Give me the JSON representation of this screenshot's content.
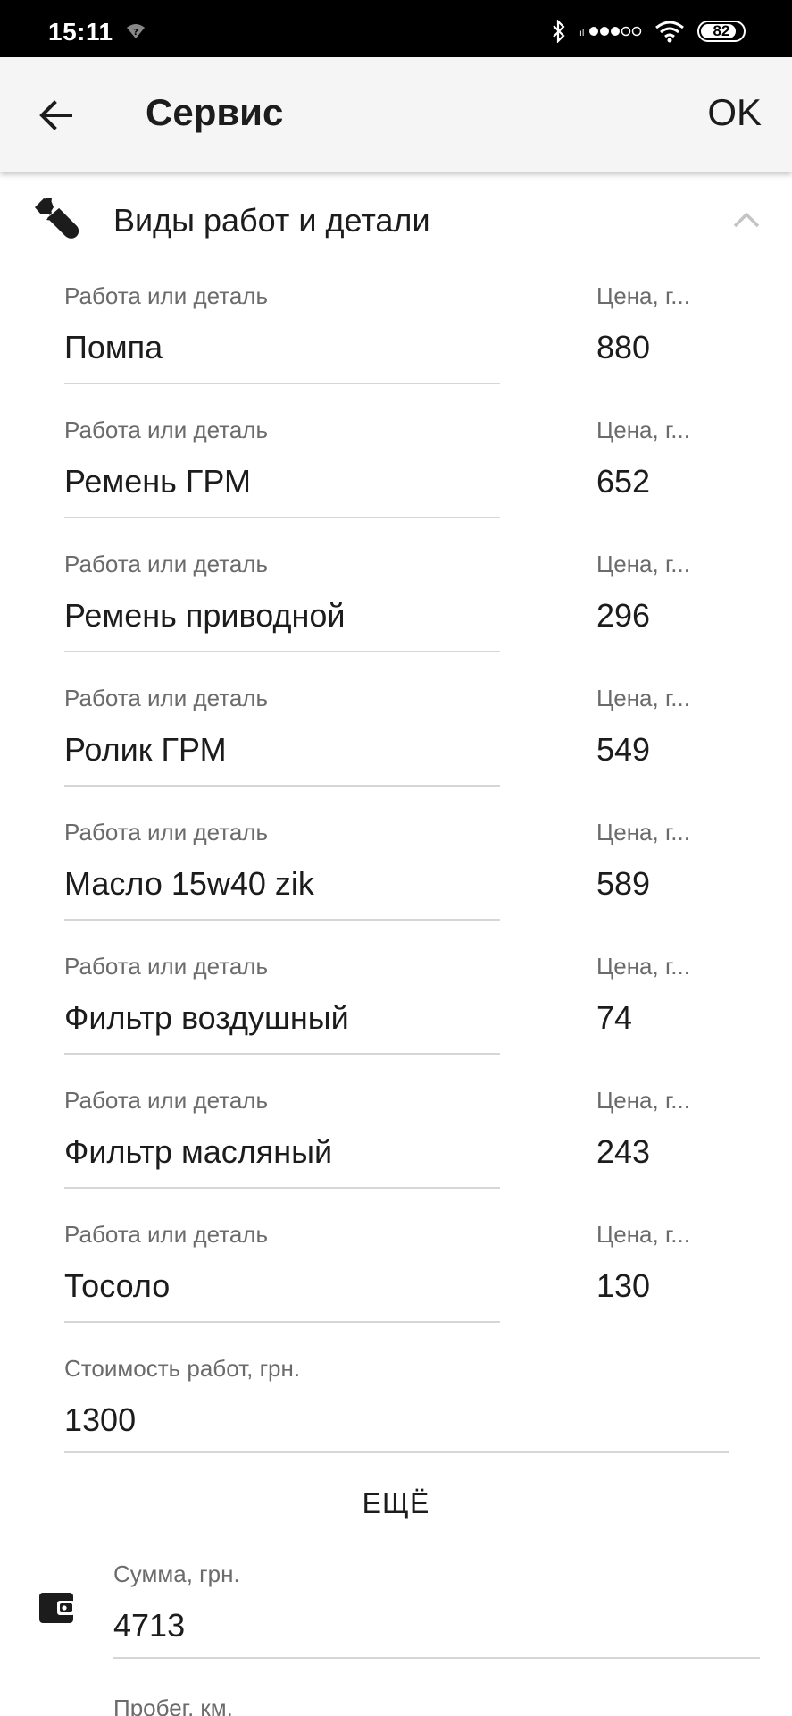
{
  "status_bar": {
    "time": "15:11",
    "battery": "82"
  },
  "app_bar": {
    "title": "Сервис",
    "ok_label": "OK"
  },
  "section": {
    "title": "Виды работ и детали"
  },
  "parts": [
    {
      "label": "Работа или деталь",
      "name": "Помпа",
      "price_label": "Цена, г...",
      "price": "880"
    },
    {
      "label": "Работа или деталь",
      "name": "Ремень ГРМ",
      "price_label": "Цена, г...",
      "price": "652"
    },
    {
      "label": "Работа или деталь",
      "name": "Ремень приводной",
      "price_label": "Цена, г...",
      "price": "296"
    },
    {
      "label": "Работа или деталь",
      "name": "Ролик ГРМ",
      "price_label": "Цена, г...",
      "price": "549"
    },
    {
      "label": "Работа или деталь",
      "name": "Масло 15w40 zik",
      "price_label": "Цена, г...",
      "price": "589"
    },
    {
      "label": "Работа или деталь",
      "name": "Фильтр воздушный",
      "price_label": "Цена, г...",
      "price": "74"
    },
    {
      "label": "Работа или деталь",
      "name": "Фильтр масляный",
      "price_label": "Цена, г...",
      "price": "243"
    },
    {
      "label": "Работа или деталь",
      "name": "Тосоло",
      "price_label": "Цена, г...",
      "price": "130"
    }
  ],
  "labor_cost": {
    "label": "Стоимость работ, грн.",
    "value": "1300"
  },
  "more_label": "ЕЩЁ",
  "total": {
    "label": "Сумма, грн.",
    "value": "4713"
  },
  "mileage": {
    "label": "Пробег, км."
  },
  "icons": {
    "back": "arrow-left-icon",
    "section": "wrench-icon",
    "collapse": "chevron-up-icon",
    "total": "wallet-icon"
  }
}
